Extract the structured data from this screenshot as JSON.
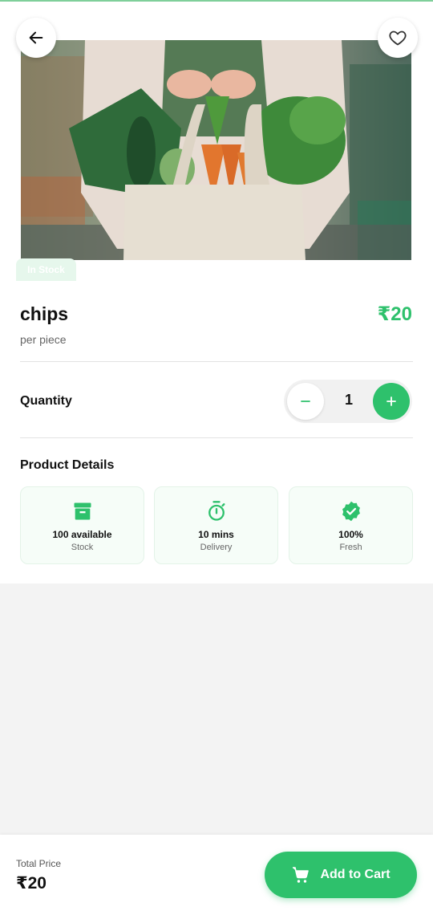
{
  "header": {
    "back_icon": "arrow-left-icon",
    "favorite_icon": "heart-outline-icon"
  },
  "product": {
    "image_alt": "hands holding a tote bag filled with vegetables",
    "stock_badge": "In Stock",
    "name": "chips",
    "price": "₹20",
    "unit": "per piece"
  },
  "quantity": {
    "label": "Quantity",
    "value": "1",
    "minus_icon": "minus-icon",
    "plus_icon": "plus-icon"
  },
  "details": {
    "title": "Product Details",
    "cards": [
      {
        "icon": "archive-box-icon",
        "value": "100 available",
        "label": "Stock"
      },
      {
        "icon": "stopwatch-icon",
        "value": "10 mins",
        "label": "Delivery"
      },
      {
        "icon": "verified-badge-icon",
        "value": "100%",
        "label": "Fresh"
      }
    ]
  },
  "footer": {
    "total_label": "Total Price",
    "total_value": "₹20",
    "cart_button_label": "Add to Cart",
    "cart_icon": "cart-icon"
  },
  "colors": {
    "accent": "#2ec16c",
    "card_bg": "#f6fdf8",
    "page_bg": "#f3f3f3"
  }
}
